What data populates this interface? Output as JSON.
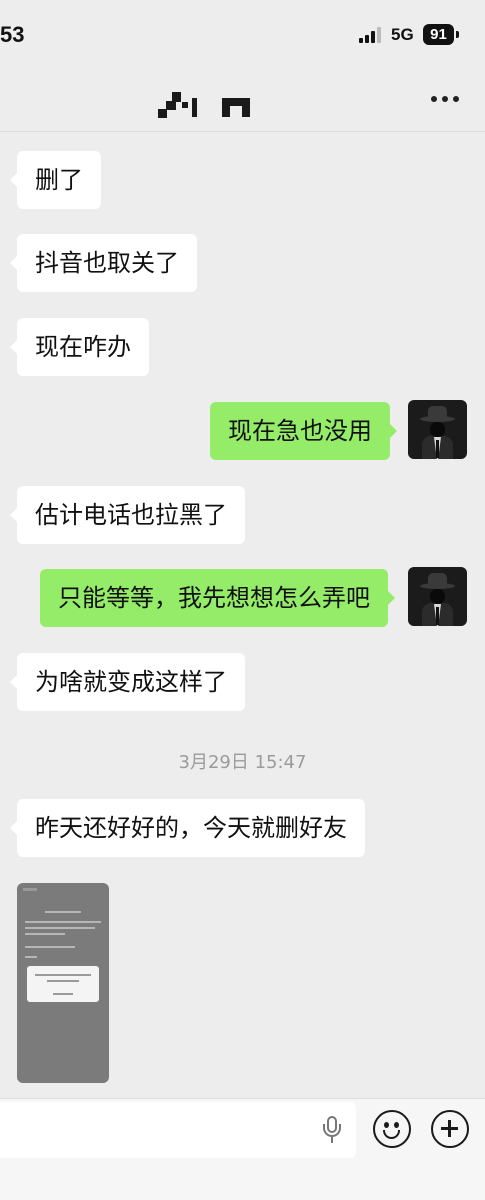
{
  "status_bar": {
    "time": "53",
    "network": "5G",
    "battery": "91"
  },
  "header": {
    "contact_name": "",
    "more_icon": "more-dots-icon"
  },
  "messages": [
    {
      "side": "in",
      "text": "删了"
    },
    {
      "side": "in",
      "text": "抖音也取关了"
    },
    {
      "side": "in",
      "text": "现在咋办"
    },
    {
      "side": "out",
      "text": "现在急也没用"
    },
    {
      "side": "in",
      "text": "估计电话也拉黑了"
    },
    {
      "side": "out",
      "text": "只能等等，我先想想怎么弄吧"
    },
    {
      "side": "in",
      "text": "为啥就变成这样了"
    },
    {
      "side": "in",
      "text": "昨天还好好的，今天就删好友"
    }
  ],
  "timestamp": "3月29日 15:47",
  "image_message": {
    "kind": "screenshot"
  },
  "colors": {
    "background": "#ededed",
    "incoming_bubble": "#ffffff",
    "outgoing_bubble": "#95ec69"
  },
  "input_bar": {
    "icons": [
      "microphone-icon",
      "emoji-icon",
      "add-icon"
    ]
  }
}
